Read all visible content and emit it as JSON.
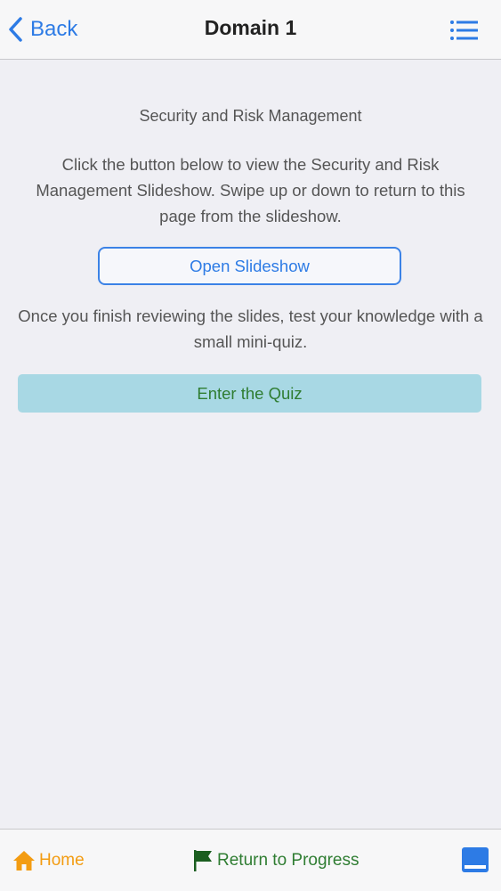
{
  "header": {
    "back_label": "Back",
    "title": "Domain 1",
    "menu_icon": "list-icon"
  },
  "main": {
    "section_title": "Security and Risk Management",
    "intro_text": "Click the button below to view the Security and Risk Management Slideshow. Swipe up or down to return to this page from the slideshow.",
    "open_slideshow_label": "Open Slideshow",
    "after_text": "Once you finish reviewing the slides, test your knowledge with a small mini-quiz.",
    "quiz_label": "Enter the Quiz"
  },
  "footer": {
    "home_label": "Home",
    "progress_label": "Return to Progress",
    "panel_icon": "panel-icon"
  },
  "colors": {
    "accent_blue": "#2d7be5",
    "home_orange": "#f39c12",
    "progress_green": "#2f7d32",
    "quiz_bg": "#a8d8e4",
    "background": "#efeff4"
  }
}
